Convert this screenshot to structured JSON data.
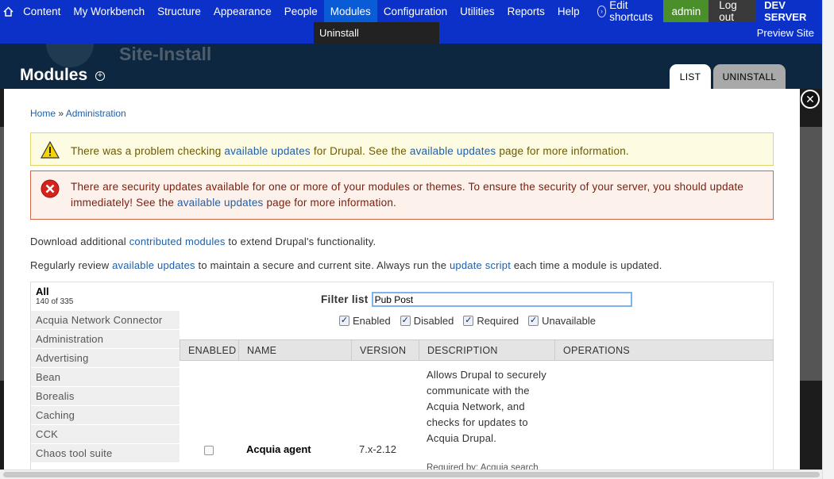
{
  "toolbar": {
    "items": [
      "Content",
      "My Workbench",
      "Structure",
      "Appearance",
      "People",
      "Modules",
      "Configuration",
      "Utilities",
      "Reports",
      "Help"
    ],
    "active": "Modules",
    "shortcuts_label": "Shortcuts",
    "edit_shortcuts_label": "Edit shortcuts",
    "user": "admin",
    "logout": "Log out",
    "server": "DEV SERVER"
  },
  "subbar": {
    "uninstall": "Uninstall",
    "preview": "Preview Site"
  },
  "header": {
    "site_name": "Site-Install",
    "title": "Modules",
    "tabs": [
      "LIST",
      "UNINSTALL"
    ]
  },
  "breadcrumb": {
    "home": "Home",
    "sep": " » ",
    "admin": "Administration"
  },
  "warning": {
    "t1": "There was a problem checking ",
    "link1": "available updates",
    "t2": " for Drupal. See the ",
    "link2": "available updates",
    "t3": " page for more information."
  },
  "error": {
    "t1": "There are security updates available for one or more of your modules or themes. To ensure the security of your server, you should update immediately! See the ",
    "link": "available updates",
    "t2": " page for more information."
  },
  "para1": {
    "t1": "Download additional ",
    "link": "contributed modules",
    "t2": " to extend Drupal's functionality."
  },
  "para2": {
    "t1": "Regularly review ",
    "link1": "available updates",
    "t2": " to maintain a secure and current site. Always run the ",
    "link2": "update script",
    "t3": " each time a module is updated."
  },
  "browser": {
    "all_label": "All",
    "all_count": "140 of 335",
    "categories": [
      "Acquia Network Connector",
      "Administration",
      "Advertising",
      "Bean",
      "Borealis",
      "Caching",
      "CCK",
      "Chaos tool suite"
    ],
    "filter_label": "Filter list",
    "filter_value": "Pub Post",
    "checks": [
      "Enabled",
      "Disabled",
      "Required",
      "Unavailable"
    ],
    "columns": [
      "ENABLED",
      "NAME",
      "VERSION",
      "DESCRIPTION",
      "OPERATIONS"
    ],
    "row": {
      "name": "Acquia agent",
      "version": "7.x-2.12",
      "description": "Allows Drupal to securely communicate with the Acquia Network, and checks for updates to Acquia Drupal.",
      "required_by": "Required by: Acquia search"
    }
  }
}
